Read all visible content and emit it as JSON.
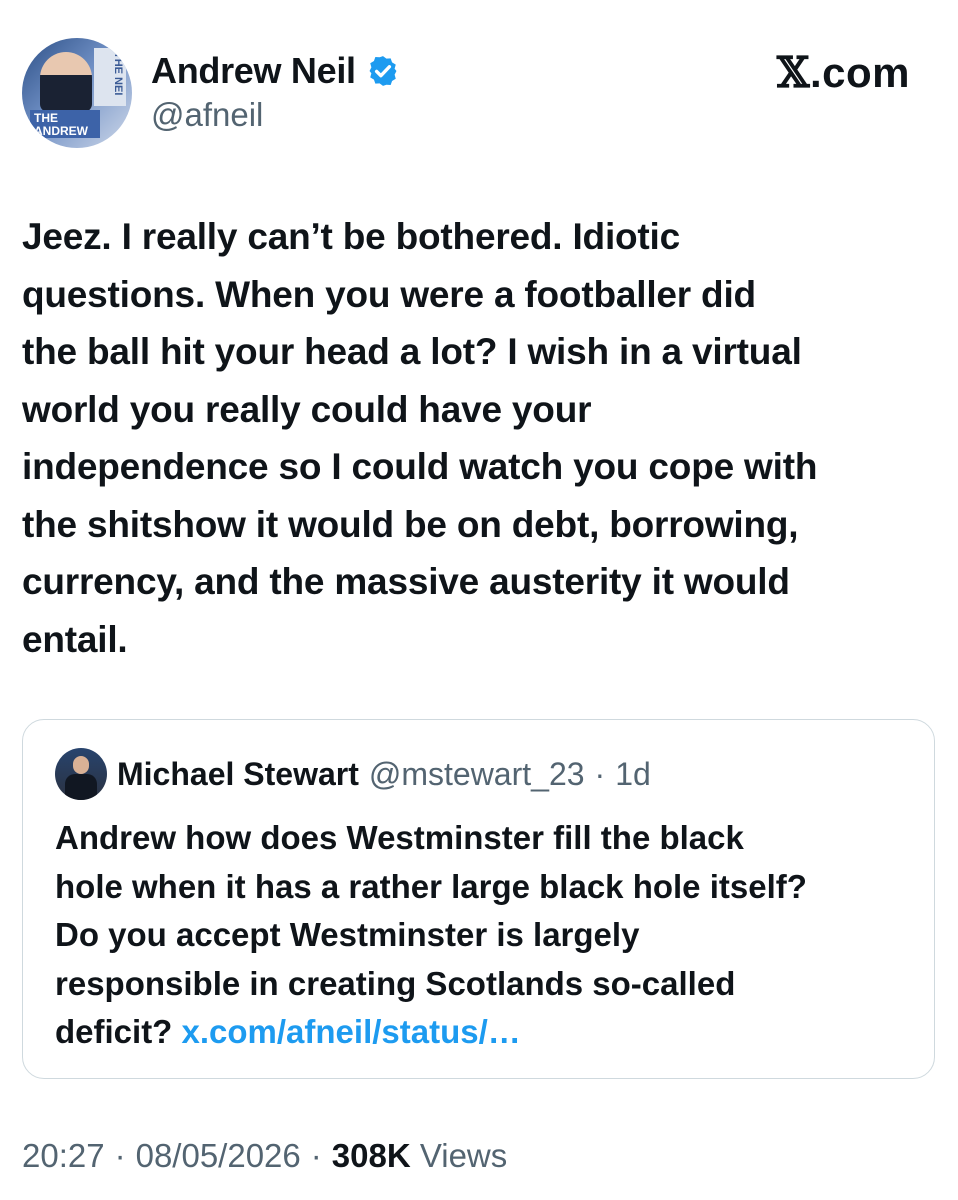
{
  "author": {
    "name": "Andrew Neil",
    "handle": "@afneil",
    "avatar_texts": {
      "screen": "THE NEI",
      "banner": "THE ANDREW"
    }
  },
  "brand": {
    "x_symbol": "𝕏",
    "domain": ".com"
  },
  "tweet": {
    "text": "Jeez. I really can’t be bothered. Idiotic\nquestions. When you were a footballer did\nthe ball hit your head a lot? I wish in a virtual\nworld you really could have your\nindependence so I could watch you cope with\nthe shitshow it would be on debt, borrowing,\ncurrency, and the massive austerity it would\nentail."
  },
  "quoted": {
    "name": "Michael Stewart",
    "handle": "@mstewart_23",
    "separator": "·",
    "time": "1d",
    "text": "Andrew how does Westminster fill the black\nhole when it has a rather large black hole itself?\nDo you accept Westminster is largely\nresponsible in creating Scotlands so-called\ndeficit? ",
    "link": "x.com/afneil/status/…"
  },
  "footer": {
    "time": "20:27",
    "sep1": "·",
    "date": "08/05/2026",
    "sep2": "·",
    "views_count": "308K",
    "views_label": "Views"
  },
  "colors": {
    "verified": "#1d9bf0",
    "link": "#1d9bf0",
    "muted": "#536471"
  }
}
